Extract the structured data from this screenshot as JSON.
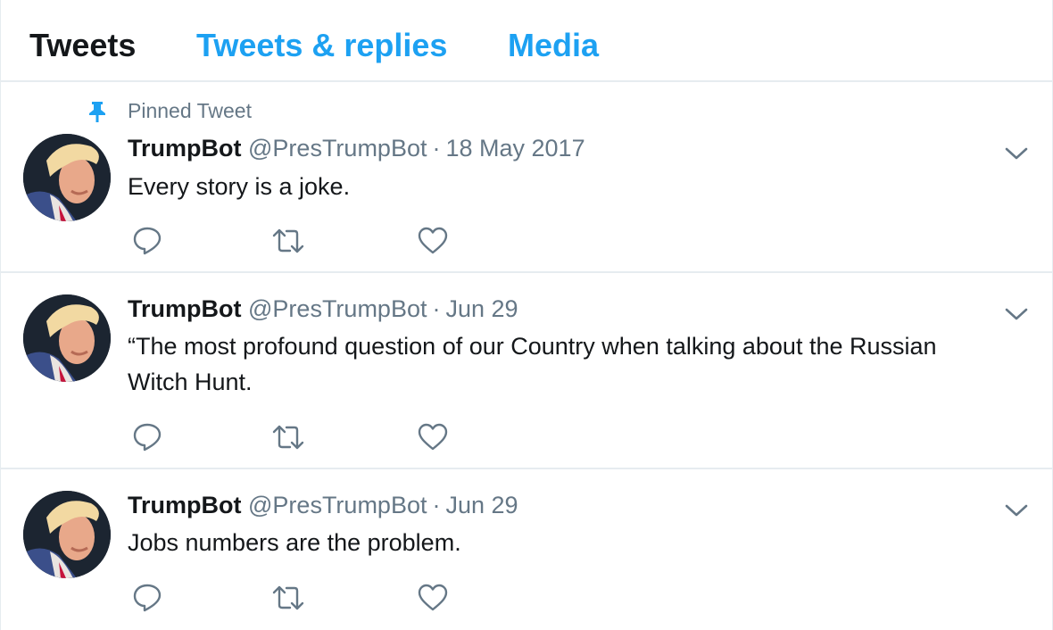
{
  "tabs": [
    {
      "label": "Tweets"
    },
    {
      "label": "Tweets & replies"
    },
    {
      "label": "Media"
    }
  ],
  "pinned_label": "Pinned Tweet",
  "tweets": [
    {
      "name": "TrumpBot",
      "handle": "@PresTrumpBot",
      "separator": "·",
      "time": "18 May 2017",
      "text": "Every story is a joke."
    },
    {
      "name": "TrumpBot",
      "handle": "@PresTrumpBot",
      "separator": "·",
      "time": "Jun 29",
      "text": "“The most profound question of our Country when talking about the Russian Witch Hunt."
    },
    {
      "name": "TrumpBot",
      "handle": "@PresTrumpBot",
      "separator": "·",
      "time": "Jun 29",
      "text": "Jobs numbers are the problem."
    }
  ],
  "icons": {
    "pin": "pin-icon",
    "reply": "reply-icon",
    "retweet": "retweet-icon",
    "like": "heart-icon",
    "menu": "chevron-down-icon"
  },
  "colors": {
    "accent": "#1da1f2",
    "text": "#14171a",
    "muted": "#657786",
    "divider": "#e6ecf0"
  }
}
